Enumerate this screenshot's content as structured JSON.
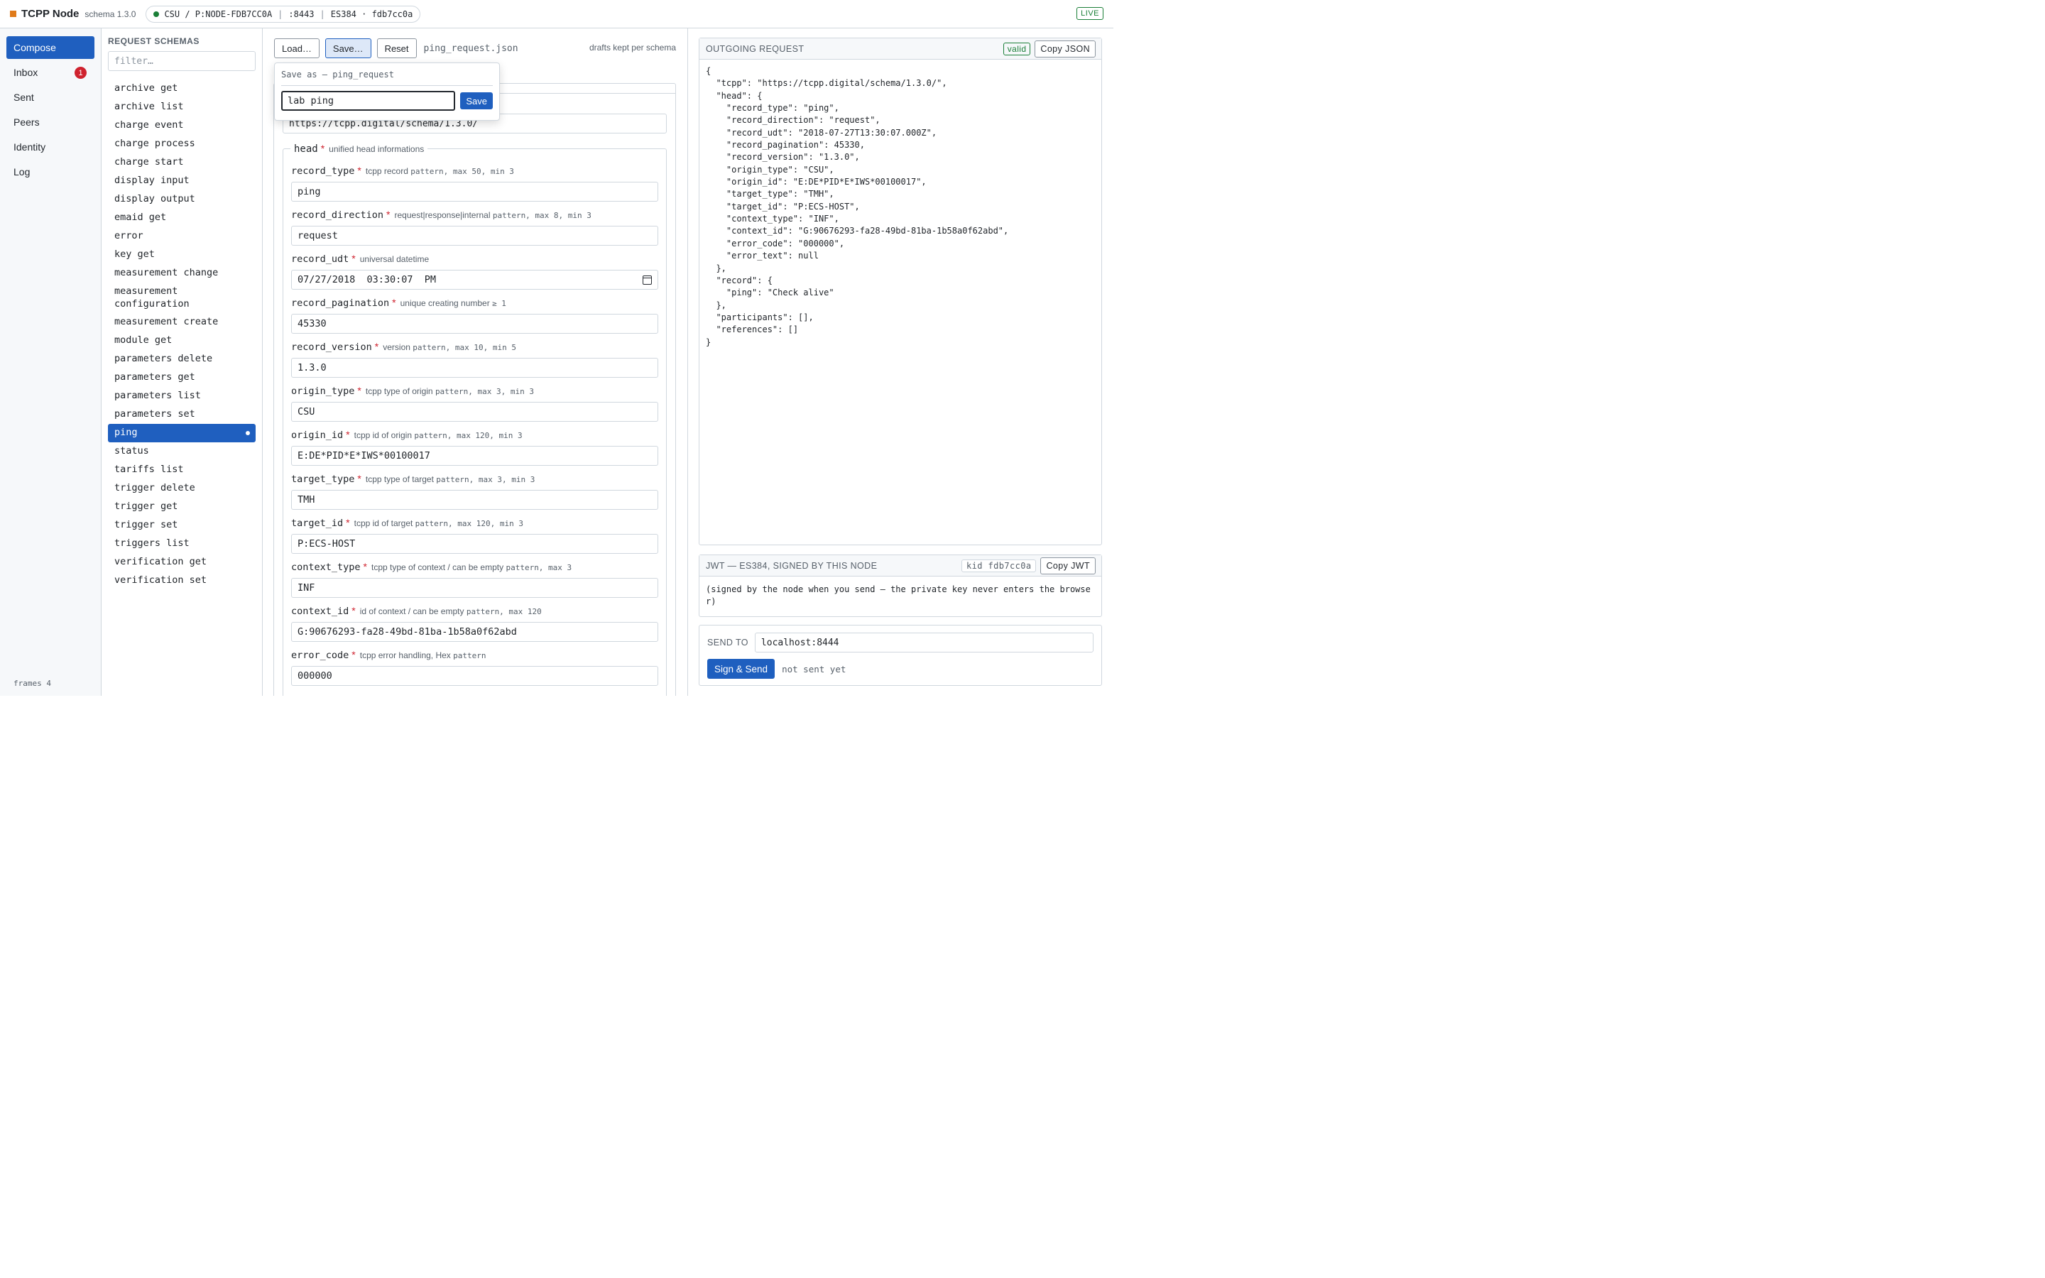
{
  "topbar": {
    "brand": "TCPP Node",
    "schema_version": "schema 1.3.0",
    "node_identity": "CSU / P:NODE-FDB7CC0A",
    "port": ":8443",
    "key_info": "ES384 · fdb7cc0a",
    "live_label": "LIVE"
  },
  "nav": {
    "items": [
      {
        "label": "Compose"
      },
      {
        "label": "Inbox",
        "badge": "1"
      },
      {
        "label": "Sent"
      },
      {
        "label": "Peers"
      },
      {
        "label": "Identity"
      },
      {
        "label": "Log"
      }
    ],
    "frames": "frames 4"
  },
  "schemas": {
    "title": "REQUEST SCHEMAS",
    "filter_placeholder": "filter…",
    "items": [
      "archive get",
      "archive list",
      "charge event",
      "charge process",
      "charge start",
      "display input",
      "display output",
      "emaid get",
      "error",
      "key get",
      "measurement change",
      "measurement configuration",
      "measurement create",
      "module get",
      "parameters delete",
      "parameters get",
      "parameters list",
      "parameters set",
      "ping",
      "status",
      "tariffs list",
      "trigger delete",
      "trigger get",
      "trigger set",
      "triggers list",
      "verification get",
      "verification set"
    ],
    "active": "ping"
  },
  "editor": {
    "load_label": "Load…",
    "save_label": "Save…",
    "reset_label": "Reset",
    "filename": "ping_request.json",
    "drafts_note": "drafts kept per schema",
    "tcpp_value": "https://tcpp.digital/schema/1.3.0/",
    "head_legend": "head",
    "head_hint": "unified head informations",
    "fields": [
      {
        "name": "record_type",
        "desc": "tcpp record",
        "rule": "pattern, max 50, min 3",
        "value": "ping"
      },
      {
        "name": "record_direction",
        "desc": "request|response|internal",
        "rule": "pattern, max 8, min 3",
        "value": "request"
      },
      {
        "name": "record_udt",
        "desc": "universal datetime",
        "rule": "",
        "value": "07/27/2018  03:30:07  PM"
      },
      {
        "name": "record_pagination",
        "desc": "unique creating number",
        "rule": "≥ 1",
        "value": "45330"
      },
      {
        "name": "record_version",
        "desc": "version",
        "rule": "pattern, max 10, min 5",
        "value": "1.3.0"
      },
      {
        "name": "origin_type",
        "desc": "tcpp type of origin",
        "rule": "pattern, max 3, min 3",
        "value": "CSU"
      },
      {
        "name": "origin_id",
        "desc": "tcpp id of origin",
        "rule": "pattern, max 120, min 3",
        "value": "E:DE*PID*E*IWS*00100017"
      },
      {
        "name": "target_type",
        "desc": "tcpp type of target",
        "rule": "pattern, max 3, min 3",
        "value": "TMH"
      },
      {
        "name": "target_id",
        "desc": "tcpp id of target",
        "rule": "pattern, max 120, min 3",
        "value": "P:ECS-HOST"
      },
      {
        "name": "context_type",
        "desc": "tcpp type of context / can be empty",
        "rule": "pattern, max 3",
        "value": "INF"
      },
      {
        "name": "context_id",
        "desc": "id of context / can be empty",
        "rule": "pattern, max 120",
        "value": "G:90676293-fa28-49bd-81ba-1b58a0f62abd"
      },
      {
        "name": "error_code",
        "desc": "tcpp error handling, Hex",
        "rule": "pattern",
        "value": "000000"
      }
    ]
  },
  "popover": {
    "title": "Save as — ping_request",
    "name_value": "lab ping",
    "save_label": "Save"
  },
  "outgoing": {
    "title": "OUTGOING REQUEST",
    "valid_label": "valid",
    "copy_label": "Copy JSON",
    "json": "{\n  \"tcpp\": \"https://tcpp.digital/schema/1.3.0/\",\n  \"head\": {\n    \"record_type\": \"ping\",\n    \"record_direction\": \"request\",\n    \"record_udt\": \"2018-07-27T13:30:07.000Z\",\n    \"record_pagination\": 45330,\n    \"record_version\": \"1.3.0\",\n    \"origin_type\": \"CSU\",\n    \"origin_id\": \"E:DE*PID*E*IWS*00100017\",\n    \"target_type\": \"TMH\",\n    \"target_id\": \"P:ECS-HOST\",\n    \"context_type\": \"INF\",\n    \"context_id\": \"G:90676293-fa28-49bd-81ba-1b58a0f62abd\",\n    \"error_code\": \"000000\",\n    \"error_text\": null\n  },\n  \"record\": {\n    \"ping\": \"Check alive\"\n  },\n  \"participants\": [],\n  \"references\": []\n}"
  },
  "jwt": {
    "title": "JWT — ES384, SIGNED BY THIS NODE",
    "kid_label": "kid fdb7cc0a",
    "copy_label": "Copy JWT",
    "body": "(signed by the node when you send — the private key never enters the browser)"
  },
  "send": {
    "label": "SEND TO",
    "target": "localhost:8444",
    "button": "Sign & Send",
    "status": "not sent yet"
  },
  "colors": {
    "accent": "#1f5fbf",
    "live_green": "#1a7f37",
    "required_red": "#cf222e",
    "brand_orange": "#e07b1a"
  }
}
